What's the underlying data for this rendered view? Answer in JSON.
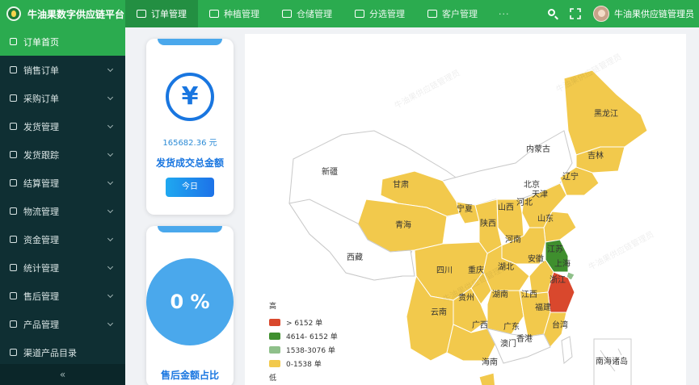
{
  "app": {
    "title": "牛油果数字供应链平台",
    "user": "牛油果供应链管理员"
  },
  "nav": {
    "items": [
      {
        "label": "订单管理",
        "active": true
      },
      {
        "label": "种植管理"
      },
      {
        "label": "仓储管理"
      },
      {
        "label": "分选管理"
      },
      {
        "label": "客户管理"
      }
    ],
    "more": "···"
  },
  "sidebar": {
    "items": [
      {
        "label": "订单首页",
        "active": true
      },
      {
        "label": "销售订单"
      },
      {
        "label": "采购订单"
      },
      {
        "label": "发货管理"
      },
      {
        "label": "发货跟踪"
      },
      {
        "label": "结算管理"
      },
      {
        "label": "物流管理"
      },
      {
        "label": "资金管理"
      },
      {
        "label": "统计管理"
      },
      {
        "label": "售后管理"
      },
      {
        "label": "产品管理"
      },
      {
        "label": "渠道产品目录"
      }
    ],
    "collapse": "«"
  },
  "cards": {
    "amount_value": "165682.36 元",
    "amount_label": "发货成交总金额",
    "today_button": "今日",
    "percent_value": "0 %",
    "percent_label": "售后金额占比",
    "yen_symbol": "¥"
  },
  "map": {
    "legend": {
      "high": "高",
      "low": "低",
      "ranges": [
        {
          "label": "> 6152 单",
          "color": "#d9482d"
        },
        {
          "label": "4614- 6152 单",
          "color": "#3f8f2e"
        },
        {
          "label": "1538-3076 单",
          "color": "#8fc08a"
        },
        {
          "label": "0-1538 单",
          "color": "#f2c94c"
        }
      ]
    },
    "provinces": {
      "heilongjiang": "黑龙江",
      "jilin": "吉林",
      "liaoning": "辽宁",
      "neimenggu": "内蒙古",
      "xinjiang": "新疆",
      "gansu": "甘肃",
      "qinghai": "青海",
      "xizang": "西藏",
      "ningxia": "宁夏",
      "shaanxi": "陕西",
      "shanxi": "山西",
      "hebei": "河北",
      "beijing": "北京",
      "tianjin": "天津",
      "shandong": "山东",
      "henan": "河南",
      "jiangsu": "江苏",
      "anhui": "安徽",
      "shanghai": "上海",
      "zhejiang": "浙江",
      "hubei": "湖北",
      "sichuan": "四川",
      "chongqing": "重庆",
      "guizhou": "贵州",
      "hunan": "湖南",
      "jiangxi": "江西",
      "fujian": "福建",
      "yunnan": "云南",
      "guangxi": "广西",
      "guangdong": "广东",
      "hongkong": "香港",
      "macau": "澳门",
      "taiwan": "台湾",
      "hainan": "海南",
      "south_sea": "南海诸岛"
    },
    "watermark": "牛油果供应链管理员"
  }
}
